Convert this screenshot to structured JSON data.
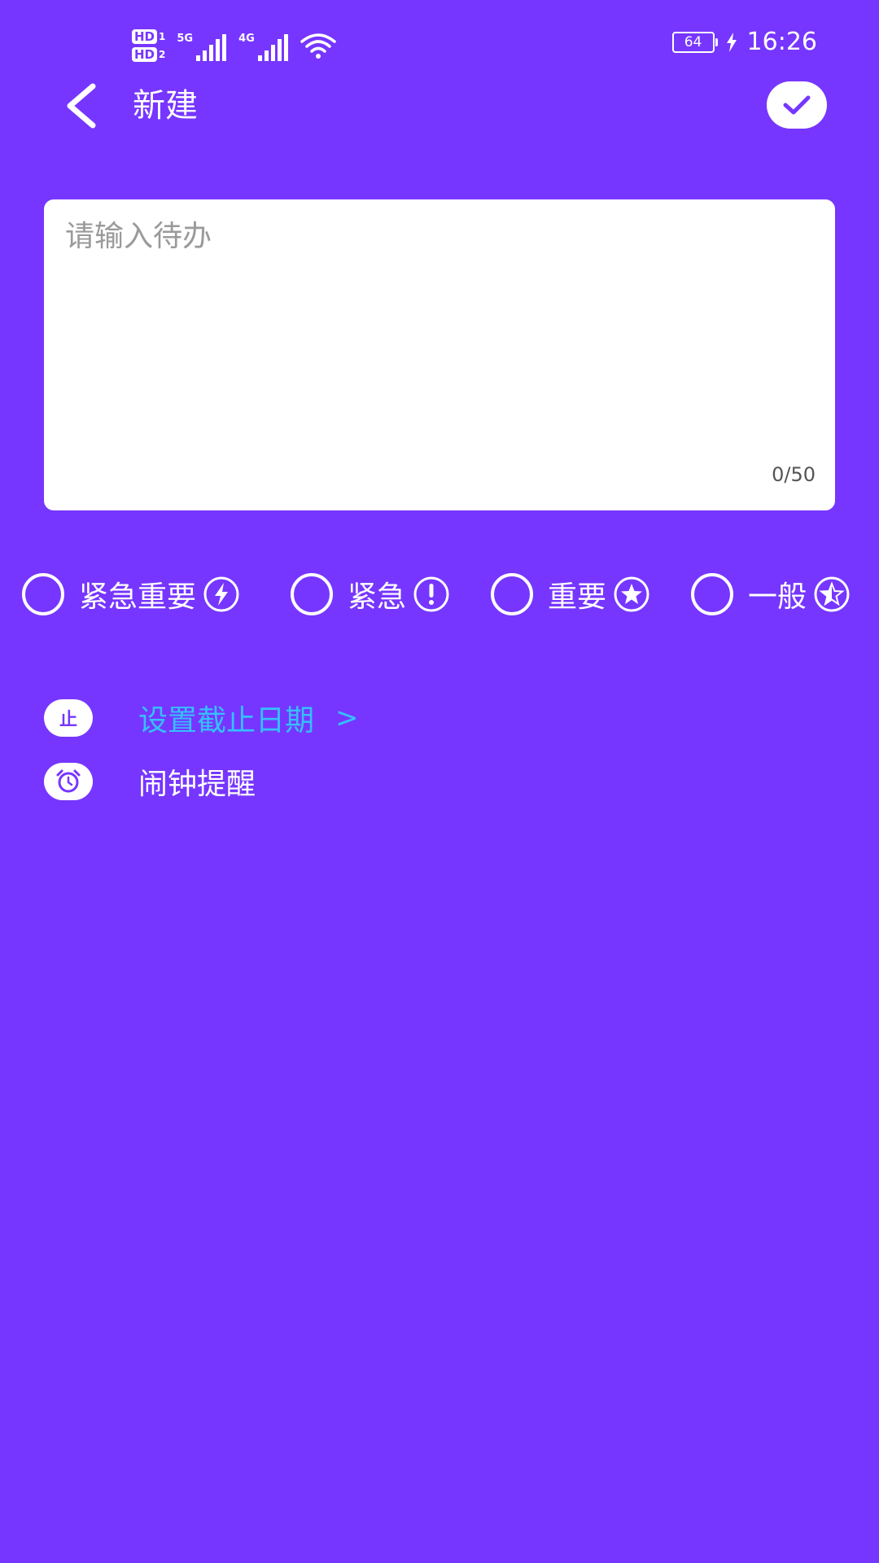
{
  "status_bar": {
    "sim1": "HD",
    "sim1_index": "1",
    "sim2": "HD",
    "sim2_index": "2",
    "net1": "5G",
    "net2": "4G",
    "battery": "64",
    "time": "16:26"
  },
  "header": {
    "title": "新建"
  },
  "input": {
    "placeholder": "请输入待办",
    "value": "",
    "counter": "0/50"
  },
  "priorities": [
    {
      "label": "紧急重要",
      "icon": "lightning-icon"
    },
    {
      "label": "紧急",
      "icon": "exclamation-icon"
    },
    {
      "label": "重要",
      "icon": "star-icon"
    },
    {
      "label": "一般",
      "icon": "half-star-icon"
    }
  ],
  "options": {
    "deadline": {
      "icon_text": "止",
      "label": "设置截止日期",
      "arrow": ">",
      "color": "#35c0ff"
    },
    "alarm": {
      "label": "闹钟提醒",
      "icon": "alarm-clock-icon"
    }
  },
  "colors": {
    "background": "#7636ff",
    "accent": "#35c0ff",
    "card": "#ffffff"
  }
}
